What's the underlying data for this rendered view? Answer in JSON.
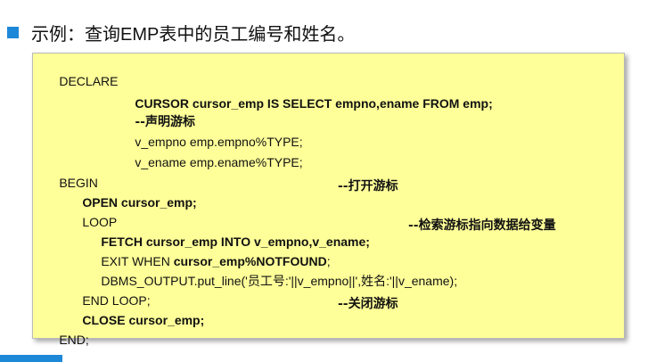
{
  "title": "示例：查询EMP表中的员工编号和姓名。",
  "colors": {
    "accent": "#1e88d8",
    "code_background": "#ffff99"
  },
  "code": {
    "l1": "DECLARE",
    "l2": "CURSOR cursor_emp IS SELECT empno,ename FROM emp;",
    "l3": "--声明游标",
    "l4": "v_empno emp.empno%TYPE;",
    "l5": "v_ename emp.ename%TYPE;",
    "l6": "BEGIN",
    "l7": "OPEN cursor_emp;",
    "l7_comment": "--打开游标",
    "l8": "LOOP",
    "l9": "FETCH cursor_emp INTO v_empno,v_ename;",
    "l9_comment": "--检索游标指向数据给变量",
    "l10_a": "EXIT WHEN ",
    "l10_b": "cursor_emp%NOTFOUND",
    "l10_c": ";",
    "l11": "DBMS_OUTPUT.put_line('员工号:'||v_empno||',姓名:'||v_ename);",
    "l12": "END LOOP;",
    "l13": "CLOSE cursor_emp;",
    "l13_comment": "--关闭游标",
    "l14": "END;"
  }
}
